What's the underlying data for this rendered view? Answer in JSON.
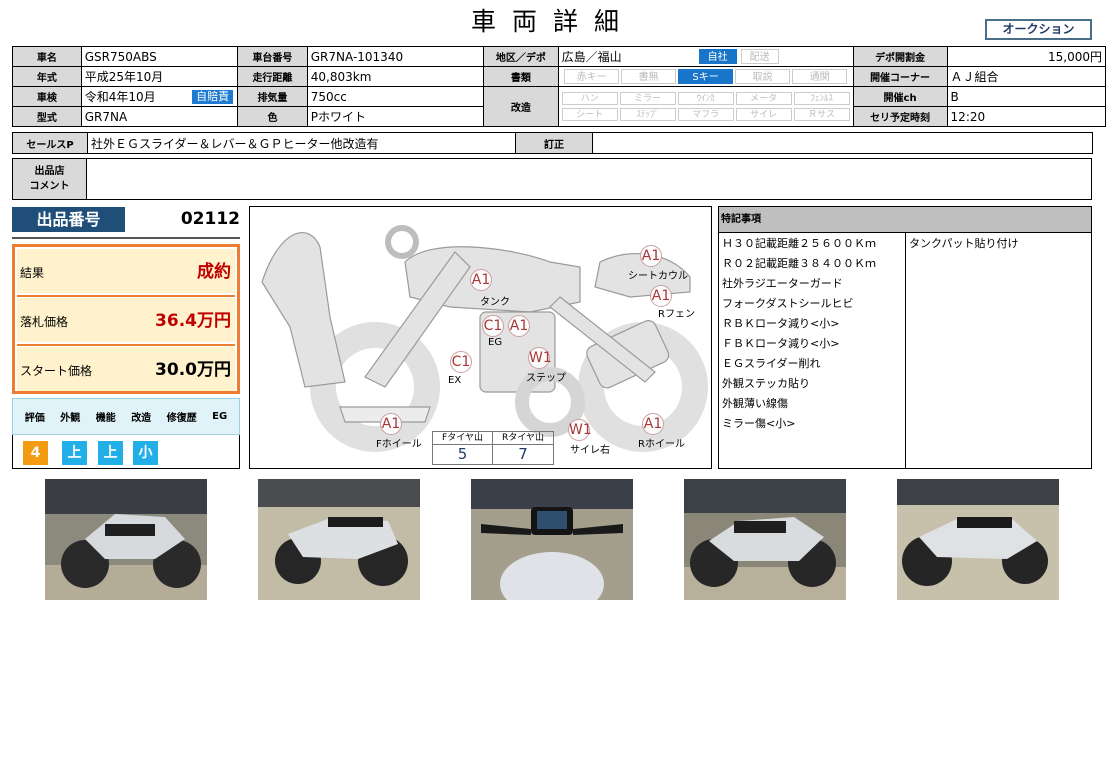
{
  "page": {
    "title": "車両詳細",
    "auction_button": "オークション"
  },
  "info": {
    "name_h": "車名",
    "name": "GSR750ABS",
    "chassis_h": "車台番号",
    "chassis": "GR7NA-101340",
    "area_h": "地区／デポ",
    "area": "広島／福山",
    "self_tag": "自社",
    "delivery_tag": "配送",
    "fee_h": "デポ開割金",
    "fee": "15,000円",
    "year_h": "年式",
    "year": "平成25年10月",
    "mileage_h": "走行距離",
    "mileage": "40,803km",
    "docs_h": "書類",
    "docs": [
      "赤キー",
      "書無",
      "Sキー",
      "取説",
      "通関"
    ],
    "corner_h": "開催コーナー",
    "corner": "ＡＪ組合",
    "inspect_h": "車検",
    "inspect": "令和4年10月",
    "insurance_tag": "自賠責",
    "cc_h": "排気量",
    "cc": "750cc",
    "mod_h": "改造",
    "mods_row1": [
      "ハン",
      "ミラー",
      "ｳｲﾝｶ",
      "メータ",
      "ﾌｪﾝﾙｽ"
    ],
    "mods_row2": [
      "シート",
      "ｽﾃｯﾌﾟ",
      "マフラ",
      "サイレ",
      "Ｒサス"
    ],
    "ch_h": "開催ch",
    "ch": "B",
    "type_h": "型式",
    "type": "GR7NA",
    "color_h": "色",
    "color": "Pホワイト",
    "time_h": "セリ予定時刻",
    "time": "12:20"
  },
  "sale": {
    "sp_h": "セールスP",
    "sp": "社外ＥＧスライダー＆レバー＆ＧＰヒーター他改造有",
    "fix_h": "訂正",
    "fix": ""
  },
  "comment": {
    "label_1": "出品店",
    "label_2": "コメント",
    "text": ""
  },
  "lot": {
    "label": "出品番号",
    "number": "02112"
  },
  "result": {
    "result_label": "結果",
    "result_value": "成約",
    "price_label": "落札価格",
    "price_value": "36.4万円",
    "start_label": "スタート価格",
    "start_value": "30.0万円"
  },
  "evaluation": {
    "headers": [
      "評価",
      "外観",
      "機能",
      "改造",
      "修復歴",
      "EG"
    ],
    "values": [
      "4",
      "上",
      "上",
      "小"
    ],
    "colors": [
      "#f39c12",
      "#22aee6",
      "#22aee6",
      "#22aee6"
    ]
  },
  "diagram": {
    "marks": [
      {
        "code": "A1",
        "label": "タンク"
      },
      {
        "code": "A1",
        "label": "シートカウル"
      },
      {
        "code": "A1",
        "label": "Rフェン"
      },
      {
        "code": "C1",
        "label": ""
      },
      {
        "code": "A1",
        "label": "EG"
      },
      {
        "code": "C1",
        "label": "EX"
      },
      {
        "code": "W1",
        "label": "ステップ"
      },
      {
        "code": "A1",
        "label": "Fホイール"
      },
      {
        "code": "W1",
        "label": "サイレ右"
      },
      {
        "code": "A1",
        "label": "Rホイール"
      }
    ],
    "tire_front_h": "Fタイヤ山",
    "tire_front": "5",
    "tire_rear_h": "Rタイヤ山",
    "tire_rear": "7"
  },
  "remarks": {
    "header": "特記事項",
    "left": [
      "Ｈ３０記載距離２５６００Ｋｍ",
      "Ｒ０２記載距離３８４００Ｋｍ",
      "社外ラジエーターガード",
      "フォークダストシールヒビ",
      "ＲＢＫロータ減り<小>",
      "ＦＢＫロータ減り<小>",
      "ＥＧスライダー削れ",
      "外観ステッカ貼り",
      "外観薄い線傷",
      "ミラー傷<小>"
    ],
    "right": [
      "タンクパット貼り付け"
    ]
  },
  "photos": [
    "photo-side-left",
    "photo-rear-left",
    "photo-cockpit",
    "photo-side-right",
    "photo-front-right"
  ]
}
